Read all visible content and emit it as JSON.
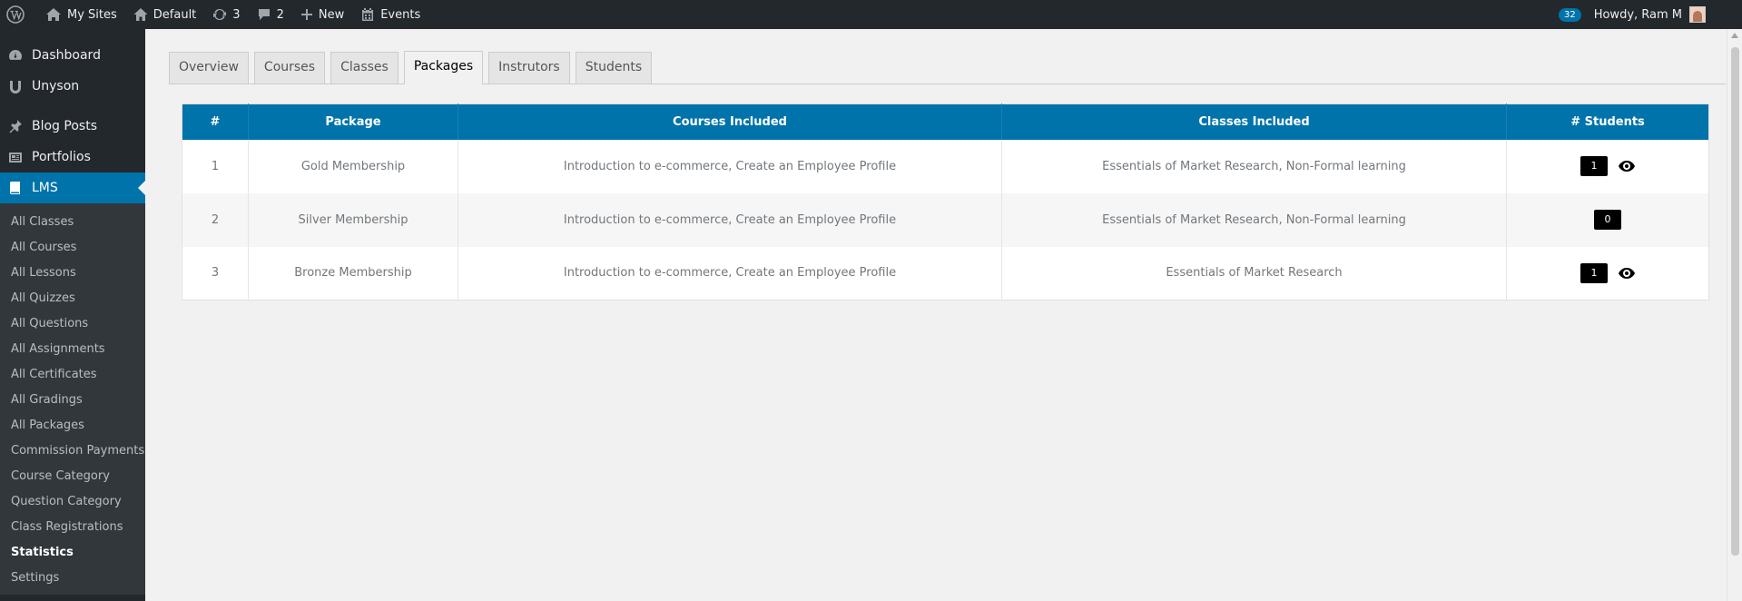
{
  "adminbar": {
    "my_sites": "My Sites",
    "site_name": "Default",
    "updates_count": "3",
    "comments_count": "2",
    "new_label": "New",
    "events_label": "Events",
    "notif_count": "32",
    "howdy": "Howdy, Ram M"
  },
  "sidebar": {
    "top_items": [
      "Dashboard",
      "Unyson",
      "Blog Posts",
      "Portfolios"
    ],
    "current_label": "LMS",
    "sub_items": [
      "All Classes",
      "All Courses",
      "All Lessons",
      "All Quizzes",
      "All Questions",
      "All Assignments",
      "All Certificates",
      "All Gradings",
      "All Packages",
      "Commission Payments",
      "Course Category",
      "Question Category",
      "Class Registrations",
      "Statistics",
      "Settings"
    ]
  },
  "tabs": [
    "Overview",
    "Courses",
    "Classes",
    "Packages",
    "Instrutors",
    "Students"
  ],
  "table": {
    "headers": [
      "#",
      "Package",
      "Courses Included",
      "Classes Included",
      "# Students"
    ],
    "rows": [
      {
        "num": "1",
        "package": "Gold Membership",
        "courses": "Introduction to e-commerce, Create an Employee Profile",
        "classes": "Essentials of Market Research, Non-Formal learning",
        "students": "1"
      },
      {
        "num": "2",
        "package": "Silver Membership",
        "courses": "Introduction to e-commerce, Create an Employee Profile",
        "classes": "Essentials of Market Research, Non-Formal learning",
        "students": "0"
      },
      {
        "num": "3",
        "package": "Bronze Membership",
        "courses": "Introduction to e-commerce, Create an Employee Profile",
        "classes": "Essentials of Market Research",
        "students": "1"
      }
    ]
  },
  "colors": {
    "adminbar_bg": "#23282d",
    "accent": "#0073aa",
    "submenu_bg": "#32373c"
  }
}
